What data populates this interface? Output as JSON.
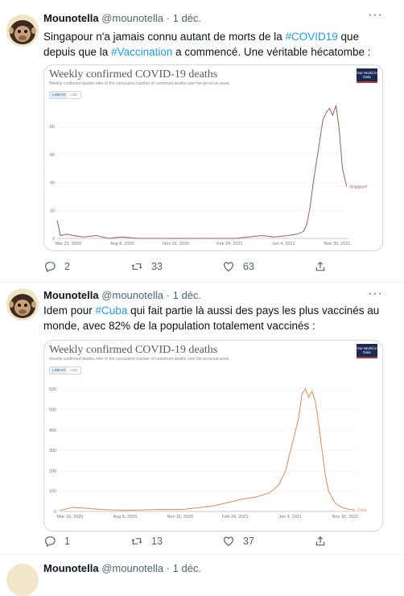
{
  "tweets": [
    {
      "name": "Mounotella",
      "handle": "@mounotella",
      "sep": "·",
      "date": "1 déc.",
      "text": {
        "p1": "Singapour n'a jamais connu autant de morts de la ",
        "tag1": "#COVID19",
        "p2": " que depuis que la ",
        "tag2": "#Vaccination",
        "p3": " a commencé. Une véritable hécatombe :"
      },
      "chart": {
        "title": "Weekly confirmed COVID-19 deaths",
        "subtitle": "Weekly confirmed deaths refer to the cumulative number of confirmed deaths over the previous week.",
        "logo": "Our World in Data",
        "toggle_linear": "LINEAR",
        "toggle_log": "LOG"
      },
      "replies": "2",
      "retweets": "33",
      "likes": "63"
    },
    {
      "name": "Mounotella",
      "handle": "@mounotella",
      "sep": "·",
      "date": "1 déc.",
      "text": {
        "p1": "Idem pour ",
        "tag1": "#Cuba",
        "p2": " qui fait partie là aussi des pays les plus vaccinés au monde, avec 82% de la population totalement vaccinés :"
      },
      "chart": {
        "title": "Weekly confirmed COVID-19 deaths",
        "subtitle": "Weekly confirmed deaths refer to the cumulative number of confirmed deaths over the previous week.",
        "logo": "Our World in Data",
        "toggle_linear": "LINEAR",
        "toggle_log": "LOG"
      },
      "replies": "1",
      "retweets": "13",
      "likes": "37"
    },
    {
      "name": "Mounotella",
      "handle": "@mounotella",
      "sep": "·",
      "date": "1 déc."
    }
  ],
  "colors": {
    "accent": "#1d9bf0",
    "singapore_line": "#a05a5f",
    "cuba_line": "#e38a4b"
  },
  "chart_data": [
    {
      "type": "line",
      "title": "Weekly confirmed COVID-19 deaths",
      "subtitle": "Weekly confirmed deaths refer to the cumulative number of confirmed deaths over the previous week.",
      "tick_labels_x": [
        "Mar 21, 2020",
        "Aug 8, 2020",
        "Nov 16, 2020",
        "Feb 24, 2021",
        "Jun 4, 2021",
        "Nov 30, 2021"
      ],
      "tick_labels_y": [
        "0",
        "20",
        "40",
        "60",
        "80"
      ],
      "ylim": [
        0,
        95
      ],
      "grid": true,
      "series": [
        {
          "name": "Singapore",
          "x": [
            "2020-03-15",
            "2020-03-22",
            "2020-04-05",
            "2020-04-19",
            "2020-05-10",
            "2020-06-07",
            "2020-07-05",
            "2020-08-02",
            "2020-09-06",
            "2020-10-04",
            "2020-11-01",
            "2020-12-06",
            "2021-01-10",
            "2021-02-07",
            "2021-03-07",
            "2021-04-04",
            "2021-05-02",
            "2021-05-30",
            "2021-06-27",
            "2021-07-25",
            "2021-08-15",
            "2021-08-29",
            "2021-09-05",
            "2021-09-12",
            "2021-09-19",
            "2021-09-26",
            "2021-10-03",
            "2021-10-10",
            "2021-10-17",
            "2021-10-24",
            "2021-10-31",
            "2021-11-07",
            "2021-11-14",
            "2021-11-21",
            "2021-11-30"
          ],
          "y": [
            13,
            2,
            3,
            2,
            1,
            2,
            0,
            1,
            0,
            0,
            0,
            0,
            0,
            0,
            0,
            0,
            1,
            2,
            1,
            2,
            3,
            5,
            10,
            22,
            40,
            55,
            70,
            85,
            90,
            93,
            88,
            95,
            78,
            50,
            37
          ]
        }
      ]
    },
    {
      "type": "line",
      "title": "Weekly confirmed COVID-19 deaths",
      "subtitle": "Weekly confirmed deaths refer to the cumulative number of confirmed deaths over the previous week.",
      "tick_labels_x": [
        "Mar 18, 2020",
        "Aug 8, 2020",
        "Nov 16, 2020",
        "Feb 24, 2021",
        "Jun 4, 2021",
        "Nov 30, 2021"
      ],
      "tick_labels_y": [
        "0",
        "100",
        "200",
        "300",
        "400",
        "500",
        "600"
      ],
      "ylim": [
        0,
        640
      ],
      "grid": true,
      "series": [
        {
          "name": "Cuba",
          "x": [
            "2020-03-18",
            "2020-04-15",
            "2020-05-13",
            "2020-06-10",
            "2020-08-05",
            "2020-10-07",
            "2020-12-02",
            "2021-01-13",
            "2021-02-10",
            "2021-03-10",
            "2021-04-07",
            "2021-05-05",
            "2021-06-02",
            "2021-06-23",
            "2021-07-07",
            "2021-07-21",
            "2021-08-04",
            "2021-08-11",
            "2021-08-18",
            "2021-08-25",
            "2021-09-01",
            "2021-09-08",
            "2021-09-15",
            "2021-09-22",
            "2021-09-29",
            "2021-10-06",
            "2021-10-20",
            "2021-11-03",
            "2021-11-17",
            "2021-11-30"
          ],
          "y": [
            5,
            20,
            15,
            10,
            5,
            10,
            10,
            20,
            30,
            45,
            60,
            70,
            90,
            130,
            200,
            330,
            460,
            580,
            600,
            560,
            590,
            540,
            430,
            300,
            180,
            100,
            40,
            20,
            10,
            8
          ]
        }
      ]
    }
  ]
}
